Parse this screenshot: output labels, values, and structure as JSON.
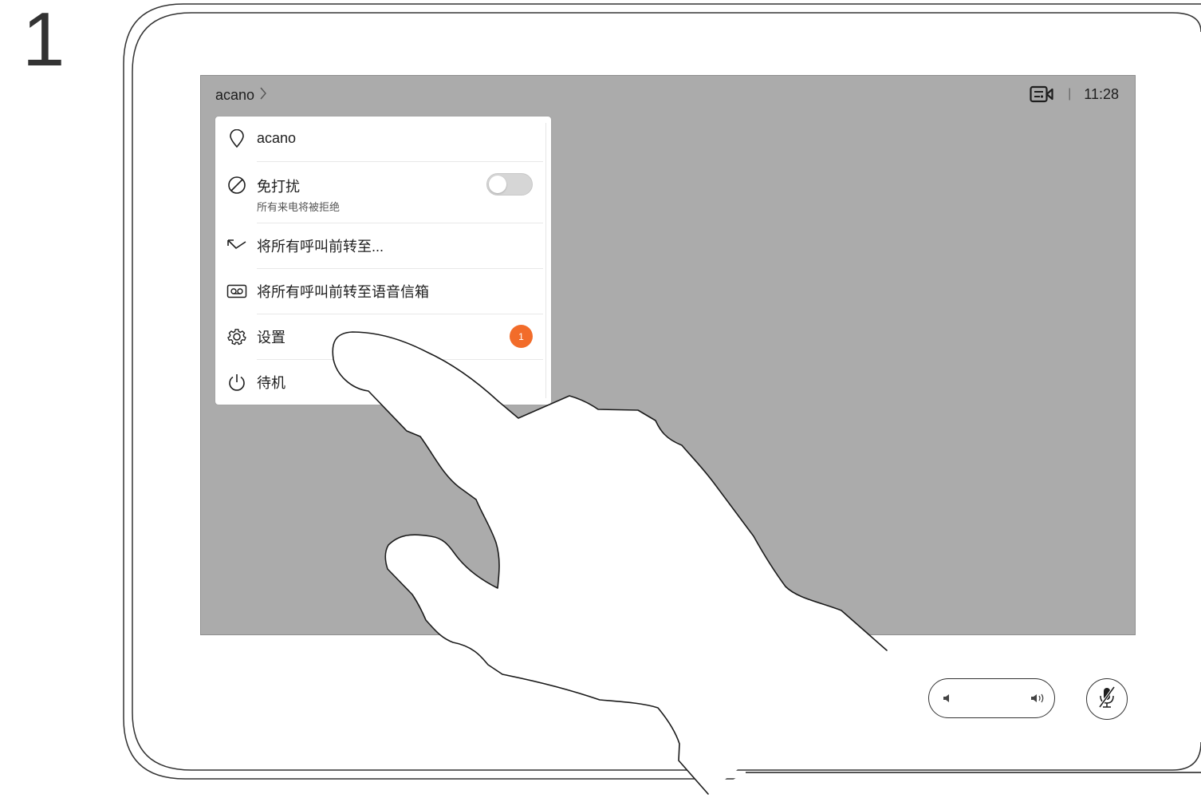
{
  "step": {
    "number": "1"
  },
  "header": {
    "breadcrumb": "acano",
    "breadcrumb_chevron": "chevron-right-icon",
    "camera_icon": "video-camera-icon",
    "separator": "|",
    "time": "11:28"
  },
  "menu": {
    "items": [
      {
        "icon": "location-pin-icon",
        "label": "acano"
      },
      {
        "icon": "do-not-disturb-icon",
        "label": "免打扰",
        "sublabel": "所有来电将被拒绝",
        "toggle_on": false
      },
      {
        "icon": "call-forward-icon",
        "label": "将所有呼叫前转至..."
      },
      {
        "icon": "voicemail-icon",
        "label": "将所有呼叫前转至语音信箱"
      },
      {
        "icon": "gear-icon",
        "label": "设置",
        "badge": "1"
      },
      {
        "icon": "power-icon",
        "label": "待机"
      }
    ]
  },
  "controls": {
    "volume_down_icon": "volume-down-icon",
    "volume_up_icon": "volume-up-icon",
    "mute_icon": "microphone-muted-icon"
  },
  "colors": {
    "screen_bg": "#ababab",
    "badge": "#f26c2a",
    "menu_bg": "#ffffff"
  }
}
